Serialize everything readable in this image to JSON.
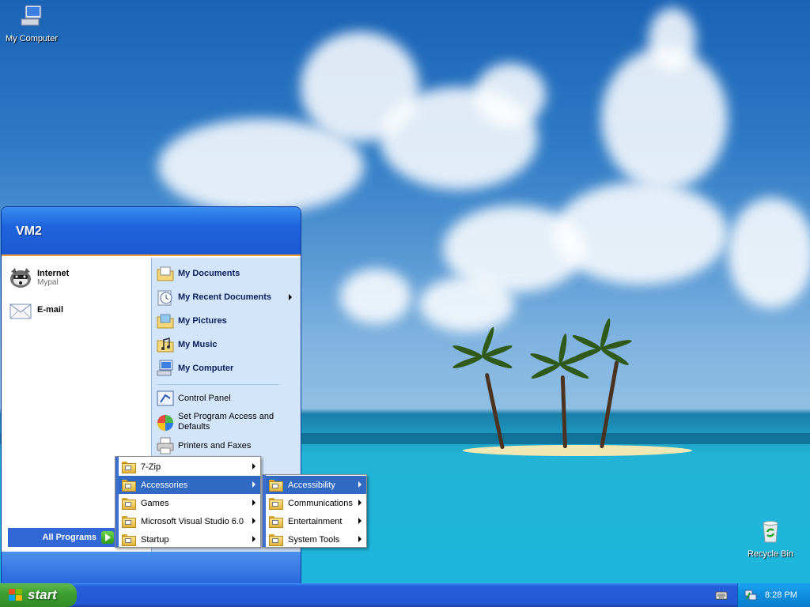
{
  "desktop": {
    "icons": [
      {
        "label": "My Computer"
      },
      {
        "label": "Recycle Bin"
      }
    ]
  },
  "start_menu": {
    "username": "VM2",
    "pinned": [
      {
        "title": "Internet",
        "subtitle": "Mypal"
      },
      {
        "title": "E-mail",
        "subtitle": ""
      }
    ],
    "all_programs_label": "All Programs",
    "right_items": [
      {
        "label": "My Documents"
      },
      {
        "label": "My Recent Documents"
      },
      {
        "label": "My Pictures"
      },
      {
        "label": "My Music"
      },
      {
        "label": "My Computer"
      },
      {
        "label": "Control Panel"
      },
      {
        "label": "Set Program Access and Defaults"
      },
      {
        "label": "Printers and Faxes"
      }
    ]
  },
  "programs_menu": {
    "items": [
      {
        "label": "7-Zip"
      },
      {
        "label": "Accessories"
      },
      {
        "label": "Games"
      },
      {
        "label": "Microsoft Visual Studio 6.0"
      },
      {
        "label": "Startup"
      }
    ]
  },
  "accessories_menu": {
    "items": [
      {
        "label": "Accessibility"
      },
      {
        "label": "Communications"
      },
      {
        "label": "Entertainment"
      },
      {
        "label": "System Tools"
      }
    ]
  },
  "taskbar": {
    "start_label": "start",
    "clock": "8:28 PM"
  },
  "colors": {
    "menu_highlight": "#316ac5",
    "start_green": "#3c9e31",
    "taskbar_blue": "#245edb"
  },
  "icons": [
    "my-computer-icon",
    "recycle-bin-icon",
    "browser-icon",
    "email-icon",
    "documents-icon",
    "recent-documents-icon",
    "pictures-icon",
    "music-icon",
    "control-panel-icon",
    "program-access-icon",
    "printer-icon",
    "folder-icon",
    "windows-flag-icon",
    "keyboard-icon",
    "network-icon"
  ]
}
